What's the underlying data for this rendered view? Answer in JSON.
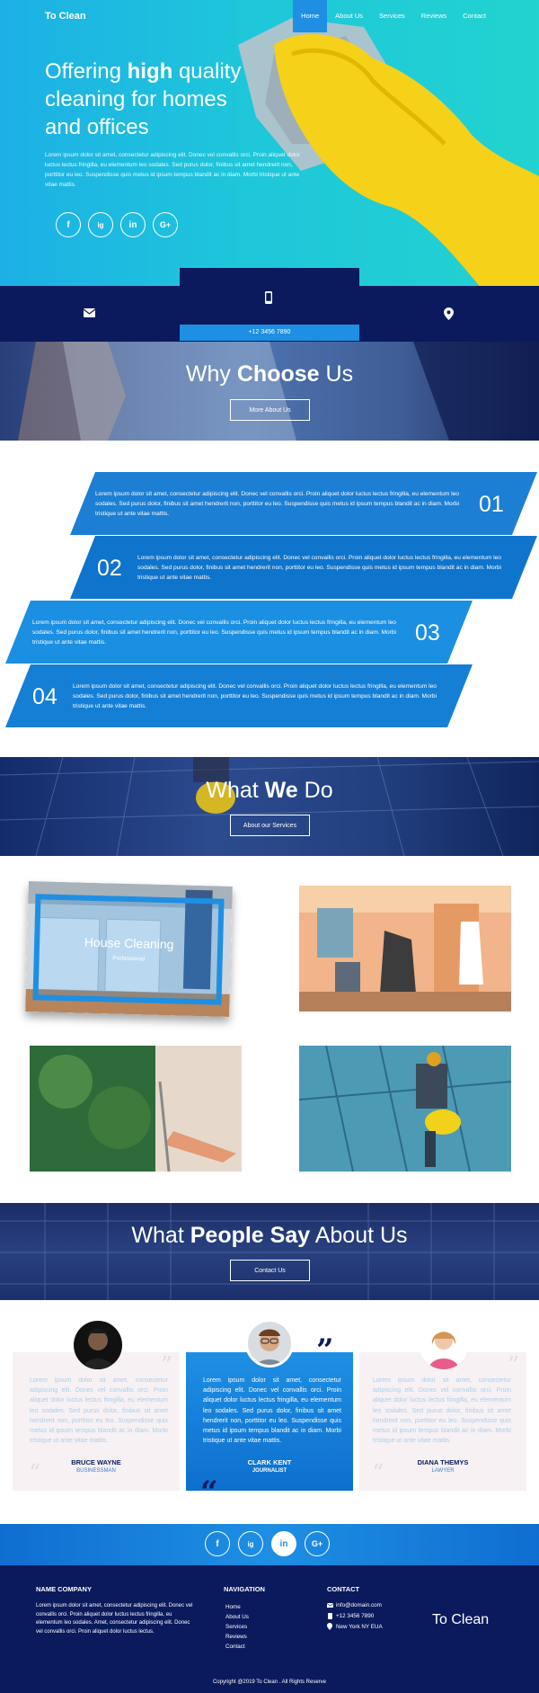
{
  "nav": {
    "logo": "To Clean",
    "items": [
      "Home",
      "About Us",
      "Services",
      "Reviews",
      "Contact"
    ]
  },
  "hero": {
    "title_1": "Offering",
    "title_bold": "high",
    "title_2": "quality",
    "title_line2": "cleaning for homes",
    "title_line3": "and offices",
    "text": "Lorem ipsum dolor sit amet, consectetur adipiscing elit. Donec vel convallis orci. Proin aliquet dolor luctus lectus fringilla, eu elementum leo sodales. Sed purus dolor, finibus sit amet hendrerit non, porttitor eu leo. Suspendisse quis metus id ipsum tempus blandit ac in diam. Morbi tristique ut ante vitae mattis.",
    "social": [
      "f",
      "ig",
      "in",
      "G+"
    ]
  },
  "contact_bar": {
    "phone": "+12 3456 7890",
    "icons": [
      "mail-icon",
      "phone-icon",
      "pin-icon"
    ]
  },
  "why": {
    "title_1": "Why",
    "title_bold": "Choose",
    "title_2": "Us",
    "button": "More About Us"
  },
  "features": [
    {
      "num": "01",
      "text": "Lorem ipsum dolor sit amet, consectetur adipiscing elit. Donec vel convallis orci. Proin aliquet dolor luctus lectus fringilla, eu elementum leo sodales. Sed purus dolor, finibus sit amet hendrerit non, porttitor eu leo. Suspendisse quis metus id ipsum tempus blandit ac in diam. Morbi tristique ut ante vitae mattis."
    },
    {
      "num": "02",
      "text": "Lorem ipsum dolor sit amet, consectetur adipiscing elit. Donec vel convallis orci. Proin aliquet dolor luctus lectus fringilla, eu elementum leo sodales. Sed purus dolor, finibus sit amet hendrerit non, porttitor eu leo. Suspendisse quis metus id ipsum tempus blandit ac in diam. Morbi tristique ut ante vitae mattis."
    },
    {
      "num": "03",
      "text": "Lorem ipsum dolor sit amet, consectetur adipiscing elit. Donec vel convallis orci. Proin aliquet dolor luctus lectus fringilla, eu elementum leo sodales. Sed purus dolor, finibus sit amet hendrerit non, porttitor eu leo. Suspendisse quis metus id ipsum tempus blandit ac in diam. Morbi tristique ut ante vitae mattis."
    },
    {
      "num": "04",
      "text": "Lorem ipsum dolor sit amet, consectetur adipiscing elit. Donec vel convallis orci. Proin aliquet dolor luctus lectus fringilla, eu elementum leo sodales. Sed purus dolor, finibus sit amet hendrerit non, porttitor eu leo. Suspendisse quis metus id ipsum tempus blandit ac in diam. Morbi tristique ut ante vitae mattis."
    }
  ],
  "what": {
    "title_1": "What",
    "title_bold": "We",
    "title_2": "Do",
    "button": "About our Services"
  },
  "services": {
    "featured_title": "House Cleaning",
    "featured_sub": "Professional"
  },
  "people": {
    "title_1": "What",
    "title_bold": "People Say",
    "title_2": "About Us",
    "button": "Contact Us"
  },
  "testimonials": [
    {
      "name": "BRUCE WAYNE",
      "role": "BUSINESSMAN",
      "text": "Lorem ipsum dolor sit amet, consectetur adipiscing elit. Donec vel convallis orci. Proin aliquet dolor luctus lectus fringilla, eu elementum leo sodales. Sed purus dolor, finibus sit amet hendrerit non, porttitor eu leo. Suspendisse quis metus id ipsum tempus blandit ac in diam. Morbi tristique ut ante vitae mattis."
    },
    {
      "name": "CLARK KENT",
      "role": "JOURNALIST",
      "text": "Lorem ipsum dolor sit amet, consectetur adipiscing elit. Donec vel convallis orci. Proin aliquet dolor luctus lectus fringilla, eu elementum leo sodales. Sed purus dolor, finibus sit amet hendrerit non, porttitor eu leo. Suspendisse quis metus id ipsum tempus blandit ac in diam. Morbi tristique ut ante vitae mattis."
    },
    {
      "name": "DIANA THEMYS",
      "role": "LAWYER",
      "text": "Lorem ipsum dolor sit amet, consectetur adipiscing elit. Donec vel convallis orci. Proin aliquet dolor luctus lectus fringilla, eu elementum leo sodales. Sed purus dolor, finibus sit amet hendrerit non, porttitor eu leo. Suspendisse quis metus id ipsum tempus blandit ac in diam. Morbi tristique ut ante vitae mattis."
    }
  ],
  "social_band": [
    "f",
    "ig",
    "in",
    "G+"
  ],
  "footer": {
    "company_heading": "NAME COMPANY",
    "company_text": "Lorem ipsum dolor sit amet, consectetur adipiscing elit. Donec vel convallis orci. Proin aliquet dolor luctus lectus fringilla, eu elementum leo sodales. Amet, consectetur adipiscing elit. Donec vel convallis orci. Proin aliquet dolor luctus lectus.",
    "nav_heading": "NAVIGATION",
    "nav_items": [
      "Home",
      "About Us",
      "Services",
      "Reviews",
      "Contact"
    ],
    "contact_heading": "CONTACT",
    "email": "info@domain.com",
    "phone": "+12 3456 7890",
    "address": "New York NY EUA",
    "brand": "To Clean",
    "copyright": "Copyright @2019 To Clean . All Rights Reserve"
  },
  "colors": {
    "navy": "#0a1a5c",
    "blue": "#1e8fe3",
    "cyan": "#1ec6da"
  }
}
